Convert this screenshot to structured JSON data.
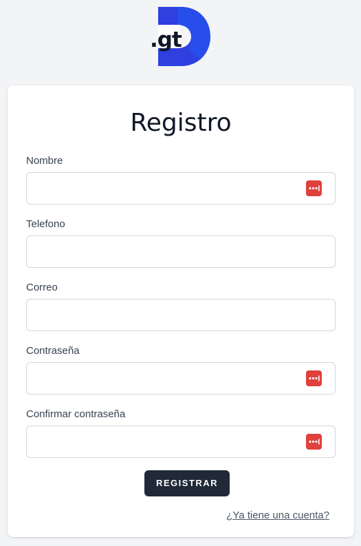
{
  "brand": {
    "logo_text": ".gt"
  },
  "form": {
    "title": "Registro",
    "fields": [
      {
        "label": "Nombre",
        "value": "",
        "has_password_icon": true
      },
      {
        "label": "Telefono",
        "value": "",
        "has_password_icon": false
      },
      {
        "label": "Correo",
        "value": "",
        "has_password_icon": false
      },
      {
        "label": "Contraseña",
        "value": "",
        "has_password_icon": true
      },
      {
        "label": "Confirmar contraseña",
        "value": "",
        "has_password_icon": true
      }
    ],
    "submit_label": "REGISTRAR",
    "login_link": "¿Ya tiene una cuenta?"
  },
  "colors": {
    "background": "#f3f4f6",
    "card": "#ffffff",
    "button": "#1f2937",
    "password_icon": "#e0413c",
    "logo_blue": "#2f3fe0"
  }
}
